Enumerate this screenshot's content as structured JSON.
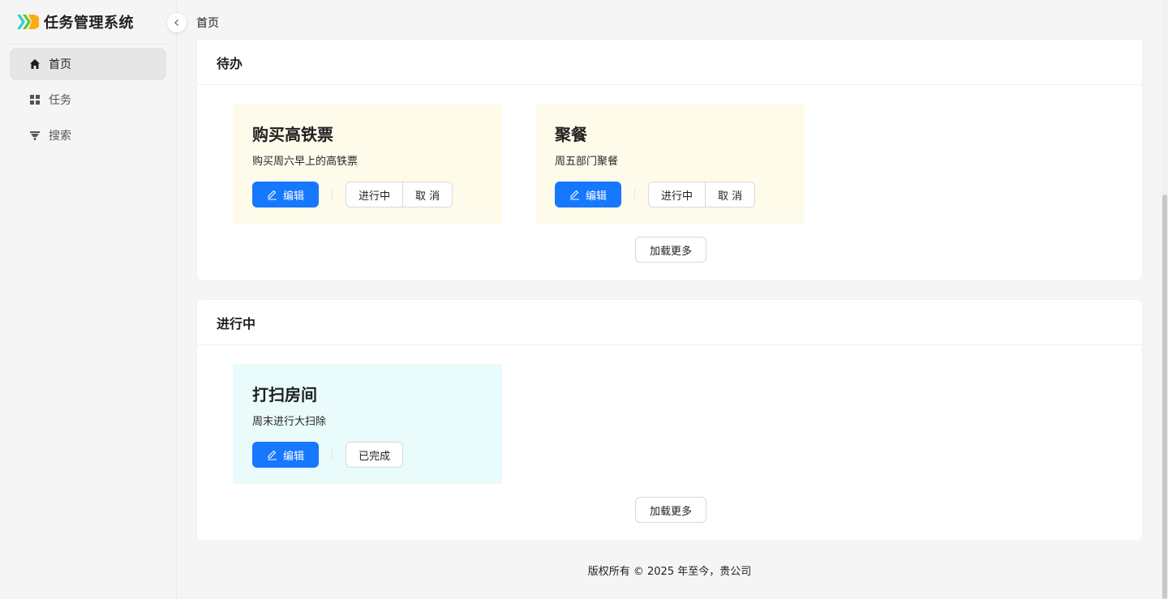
{
  "app": {
    "title": "任务管理系统"
  },
  "sidebar": {
    "items": [
      {
        "label": "首页",
        "icon": "home-icon",
        "active": true
      },
      {
        "label": "任务",
        "icon": "grid-icon",
        "active": false
      },
      {
        "label": "搜索",
        "icon": "filter-icon",
        "active": false
      }
    ]
  },
  "breadcrumb": "首页",
  "sections": [
    {
      "title": "待办",
      "cards": [
        {
          "title": "购买高铁票",
          "desc": "购买周六早上的高铁票",
          "edit": "编辑",
          "actions": [
            "进行中",
            "取 消"
          ],
          "bg": "#fffbeb"
        },
        {
          "title": "聚餐",
          "desc": "周五部门聚餐",
          "edit": "编辑",
          "actions": [
            "进行中",
            "取 消"
          ],
          "bg": "#fffbeb"
        }
      ],
      "load_more": "加载更多"
    },
    {
      "title": "进行中",
      "cards": [
        {
          "title": "打扫房间",
          "desc": "周末进行大扫除",
          "edit": "编辑",
          "actions": [
            "已完成"
          ],
          "bg": "#e9fbfb"
        }
      ],
      "load_more": "加载更多"
    }
  ],
  "footer": "版权所有 © 2025 年至今，贵公司",
  "colors": {
    "primary": "#1677ff",
    "todo_card": "#fffbeb",
    "doing_card": "#e9fbfb"
  }
}
